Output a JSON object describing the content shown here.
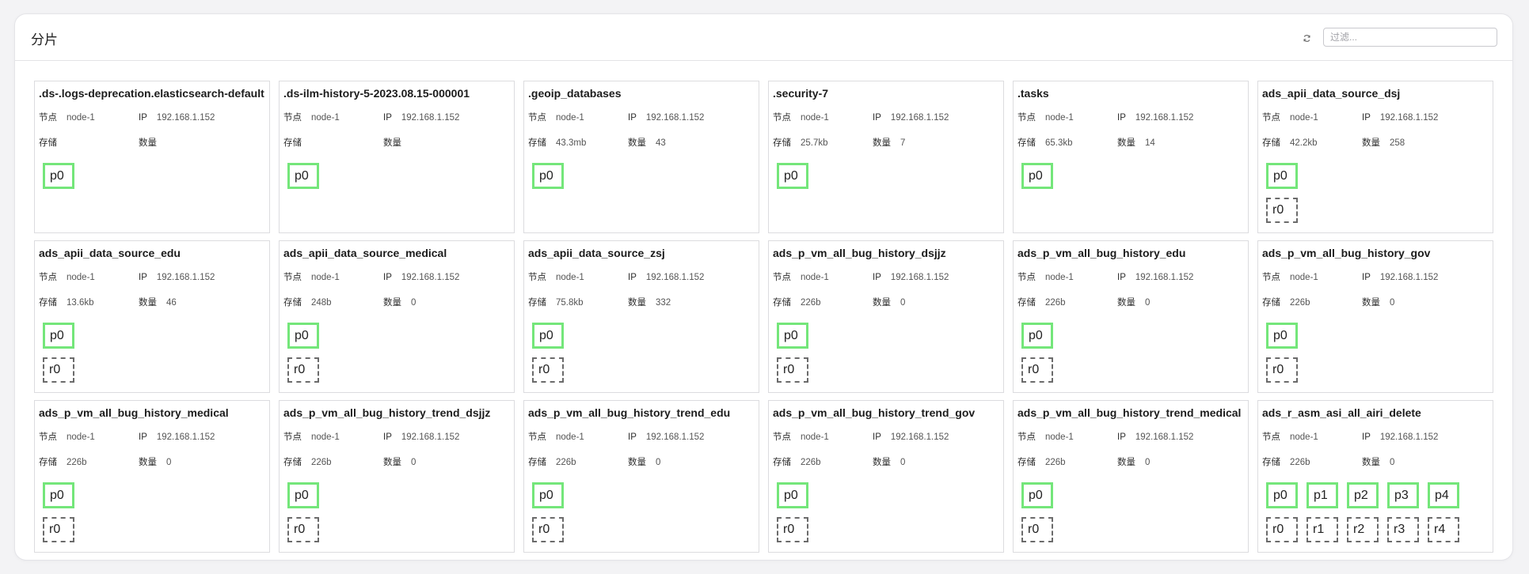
{
  "header": {
    "title": "分片",
    "filter_placeholder": "过滤..."
  },
  "labels": {
    "node": "节点",
    "ip": "IP",
    "storage": "存储",
    "count": "数量"
  },
  "colors": {
    "primary_border": "#74e67a",
    "replica_border": "#6b6b6b"
  },
  "indices": [
    {
      "name": ".ds-.logs-deprecation.elasticsearch-default",
      "node": "node-1",
      "ip": "192.168.1.152",
      "storage": "",
      "count": "",
      "primaries": [
        "p0"
      ],
      "replicas": []
    },
    {
      "name": ".ds-ilm-history-5-2023.08.15-000001",
      "node": "node-1",
      "ip": "192.168.1.152",
      "storage": "",
      "count": "",
      "primaries": [
        "p0"
      ],
      "replicas": []
    },
    {
      "name": ".geoip_databases",
      "node": "node-1",
      "ip": "192.168.1.152",
      "storage": "43.3mb",
      "count": "43",
      "primaries": [
        "p0"
      ],
      "replicas": []
    },
    {
      "name": ".security-7",
      "node": "node-1",
      "ip": "192.168.1.152",
      "storage": "25.7kb",
      "count": "7",
      "primaries": [
        "p0"
      ],
      "replicas": []
    },
    {
      "name": ".tasks",
      "node": "node-1",
      "ip": "192.168.1.152",
      "storage": "65.3kb",
      "count": "14",
      "primaries": [
        "p0"
      ],
      "replicas": []
    },
    {
      "name": "ads_apii_data_source_dsj",
      "node": "node-1",
      "ip": "192.168.1.152",
      "storage": "42.2kb",
      "count": "258",
      "primaries": [
        "p0"
      ],
      "replicas": [
        "r0"
      ]
    },
    {
      "name": "ads_apii_data_source_edu",
      "node": "node-1",
      "ip": "192.168.1.152",
      "storage": "13.6kb",
      "count": "46",
      "primaries": [
        "p0"
      ],
      "replicas": [
        "r0"
      ]
    },
    {
      "name": "ads_apii_data_source_medical",
      "node": "node-1",
      "ip": "192.168.1.152",
      "storage": "248b",
      "count": "0",
      "primaries": [
        "p0"
      ],
      "replicas": [
        "r0"
      ]
    },
    {
      "name": "ads_apii_data_source_zsj",
      "node": "node-1",
      "ip": "192.168.1.152",
      "storage": "75.8kb",
      "count": "332",
      "primaries": [
        "p0"
      ],
      "replicas": [
        "r0"
      ]
    },
    {
      "name": "ads_p_vm_all_bug_history_dsjjz",
      "node": "node-1",
      "ip": "192.168.1.152",
      "storage": "226b",
      "count": "0",
      "primaries": [
        "p0"
      ],
      "replicas": [
        "r0"
      ]
    },
    {
      "name": "ads_p_vm_all_bug_history_edu",
      "node": "node-1",
      "ip": "192.168.1.152",
      "storage": "226b",
      "count": "0",
      "primaries": [
        "p0"
      ],
      "replicas": [
        "r0"
      ]
    },
    {
      "name": "ads_p_vm_all_bug_history_gov",
      "node": "node-1",
      "ip": "192.168.1.152",
      "storage": "226b",
      "count": "0",
      "primaries": [
        "p0"
      ],
      "replicas": [
        "r0"
      ]
    },
    {
      "name": "ads_p_vm_all_bug_history_medical",
      "node": "node-1",
      "ip": "192.168.1.152",
      "storage": "226b",
      "count": "0",
      "primaries": [
        "p0"
      ],
      "replicas": [
        "r0"
      ]
    },
    {
      "name": "ads_p_vm_all_bug_history_trend_dsjjz",
      "node": "node-1",
      "ip": "192.168.1.152",
      "storage": "226b",
      "count": "0",
      "primaries": [
        "p0"
      ],
      "replicas": [
        "r0"
      ]
    },
    {
      "name": "ads_p_vm_all_bug_history_trend_edu",
      "node": "node-1",
      "ip": "192.168.1.152",
      "storage": "226b",
      "count": "0",
      "primaries": [
        "p0"
      ],
      "replicas": [
        "r0"
      ]
    },
    {
      "name": "ads_p_vm_all_bug_history_trend_gov",
      "node": "node-1",
      "ip": "192.168.1.152",
      "storage": "226b",
      "count": "0",
      "primaries": [
        "p0"
      ],
      "replicas": [
        "r0"
      ]
    },
    {
      "name": "ads_p_vm_all_bug_history_trend_medical",
      "node": "node-1",
      "ip": "192.168.1.152",
      "storage": "226b",
      "count": "0",
      "primaries": [
        "p0"
      ],
      "replicas": [
        "r0"
      ]
    },
    {
      "name": "ads_r_asm_asi_all_airi_delete",
      "node": "node-1",
      "ip": "192.168.1.152",
      "storage": "226b",
      "count": "0",
      "primaries": [
        "p0",
        "p1",
        "p2",
        "p3",
        "p4"
      ],
      "replicas": [
        "r0",
        "r1",
        "r2",
        "r3",
        "r4"
      ]
    }
  ]
}
